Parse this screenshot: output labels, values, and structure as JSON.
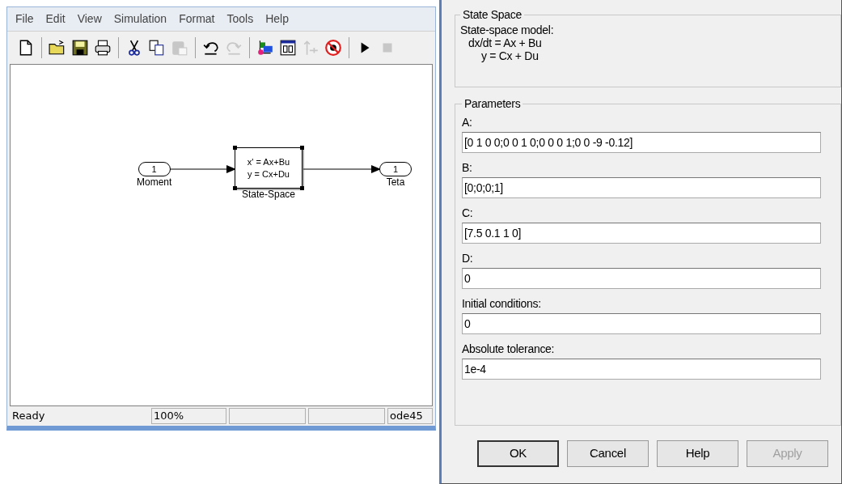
{
  "editor": {
    "menu": [
      "File",
      "Edit",
      "View",
      "Simulation",
      "Format",
      "Tools",
      "Help"
    ],
    "toolbar": [
      {
        "kind": "new",
        "disabled": false
      },
      {
        "kind": "separator"
      },
      {
        "kind": "open",
        "disabled": false
      },
      {
        "kind": "save",
        "disabled": false
      },
      {
        "kind": "print",
        "disabled": false
      },
      {
        "kind": "separator"
      },
      {
        "kind": "cut",
        "disabled": false
      },
      {
        "kind": "copy",
        "disabled": false
      },
      {
        "kind": "paste",
        "disabled": true
      },
      {
        "kind": "separator"
      },
      {
        "kind": "undo",
        "disabled": false
      },
      {
        "kind": "redo",
        "disabled": true
      },
      {
        "kind": "separator"
      },
      {
        "kind": "library",
        "disabled": false
      },
      {
        "kind": "explorer",
        "disabled": false
      },
      {
        "kind": "signal",
        "disabled": true
      },
      {
        "kind": "debug",
        "disabled": false
      },
      {
        "kind": "separator"
      },
      {
        "kind": "play",
        "disabled": false
      },
      {
        "kind": "stop",
        "disabled": true
      }
    ],
    "diagram": {
      "inport": {
        "number": "1",
        "label": "Moment"
      },
      "block": {
        "lines": [
          "x' = Ax+Bu",
          "y = Cx+Du"
        ],
        "label": "State-Space",
        "selected": true
      },
      "outport": {
        "number": "1",
        "label": "Teta"
      }
    },
    "status_bar": {
      "message": "Ready",
      "zoom": "100%",
      "solver": "ode45"
    }
  },
  "dialog": {
    "group": "State Space",
    "description": [
      "State-space model:",
      "dx/dt = Ax + Bu",
      "y = Cx + Du"
    ],
    "parameters_title": "Parameters",
    "parameters": [
      {
        "label": "A:",
        "value": "[0 1 0 0;0 0 1 0;0 0 0 1;0 0 -9 -0.12]"
      },
      {
        "label": "B:",
        "value": "[0;0;0;1]"
      },
      {
        "label": "C:",
        "value": "[7.5 0.1 1 0]"
      },
      {
        "label": "D:",
        "value": "0"
      },
      {
        "label": "Initial conditions:",
        "value": "0"
      },
      {
        "label": "Absolute tolerance:",
        "value": "1e-4"
      }
    ],
    "buttons": [
      {
        "label": "OK",
        "default": true,
        "disabled": false
      },
      {
        "label": "Cancel",
        "default": false,
        "disabled": false
      },
      {
        "label": "Help",
        "default": false,
        "disabled": false
      },
      {
        "label": "Apply",
        "default": false,
        "disabled": true
      }
    ]
  }
}
